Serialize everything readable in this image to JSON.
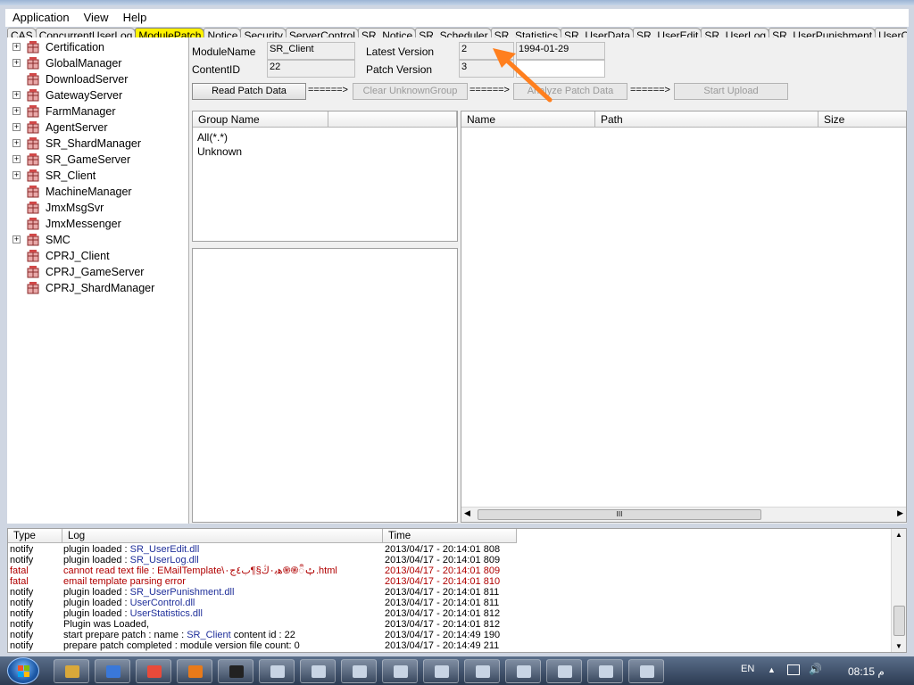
{
  "menu": [
    "Application",
    "View",
    "Help"
  ],
  "tabs": [
    "CAS",
    "ConcurrentUserLog",
    "ModulePatch",
    "Notice",
    "Security",
    "ServerControl",
    "SR_Notice",
    "SR_Scheduler",
    "SR_Statistics",
    "SR_UserData",
    "SR_UserEdit",
    "SR_UserLog",
    "SR_UserPunishment",
    "UserControl"
  ],
  "active_tab": "ModulePatch",
  "tree": [
    {
      "label": "Certification",
      "expandable": true
    },
    {
      "label": "GlobalManager",
      "expandable": true
    },
    {
      "label": "DownloadServer",
      "expandable": false
    },
    {
      "label": "GatewayServer",
      "expandable": true
    },
    {
      "label": "FarmManager",
      "expandable": true
    },
    {
      "label": "AgentServer",
      "expandable": true
    },
    {
      "label": "SR_ShardManager",
      "expandable": true
    },
    {
      "label": "SR_GameServer",
      "expandable": true
    },
    {
      "label": "SR_Client",
      "expandable": true
    },
    {
      "label": "MachineManager",
      "expandable": false
    },
    {
      "label": "JmxMsgSvr",
      "expandable": false
    },
    {
      "label": "JmxMessenger",
      "expandable": false
    },
    {
      "label": "SMC",
      "expandable": true
    },
    {
      "label": "CPRJ_Client",
      "expandable": false
    },
    {
      "label": "CPRJ_GameServer",
      "expandable": false
    },
    {
      "label": "CPRJ_ShardManager",
      "expandable": false
    }
  ],
  "module": {
    "module_name_label": "ModuleName",
    "module_name": "SR_Client",
    "content_id_label": "ContentID",
    "content_id": "22",
    "latest_version_label": "Latest Version",
    "latest_version": "2",
    "latest_date": "1994-01-29",
    "patch_version_label": "Patch Version",
    "patch_version": "3",
    "patch_date": ""
  },
  "actions": {
    "read_patch": "Read Patch Data",
    "arrow1": "======>",
    "clear_unknown": "Clear UnknownGroup",
    "arrow2": "======>",
    "analyze": "Analyze Patch Data",
    "arrow3": "======>",
    "start_upload": "Start Upload"
  },
  "groups": {
    "header": "Group Name",
    "items": [
      "All(*.*)",
      "Unknown"
    ]
  },
  "files": {
    "headers": [
      "Name",
      "Path",
      "Size"
    ],
    "scroll_grip": "III"
  },
  "log": {
    "headers": [
      "Type",
      "Log",
      "Time"
    ],
    "rows": [
      {
        "type": "notify",
        "msg_prefix": "plugin loaded : ",
        "msg_hl": "SR_UserEdit.dll",
        "msg_suffix": "",
        "time": "2013/04/17 - 20:14:01 808"
      },
      {
        "type": "notify",
        "msg_prefix": "plugin loaded : ",
        "msg_hl": "SR_UserLog.dll",
        "msg_suffix": "",
        "time": "2013/04/17 - 20:14:01 809"
      },
      {
        "type": "fatal",
        "msg_prefix": "cannot read text file : EMailTemplate\\ࢡᬀ֎֍ﻫﺑ۰ڭ§¶ﺏ٤ﺝ۰.html",
        "msg_hl": "",
        "msg_suffix": "",
        "time": "2013/04/17 - 20:14:01 809"
      },
      {
        "type": "fatal",
        "msg_prefix": "email template parsing error",
        "msg_hl": "",
        "msg_suffix": "",
        "time": "2013/04/17 - 20:14:01 810"
      },
      {
        "type": "notify",
        "msg_prefix": "plugin loaded : ",
        "msg_hl": "SR_UserPunishment.dll",
        "msg_suffix": "",
        "time": "2013/04/17 - 20:14:01 811"
      },
      {
        "type": "notify",
        "msg_prefix": "plugin loaded : ",
        "msg_hl": "UserControl.dll",
        "msg_suffix": "",
        "time": "2013/04/17 - 20:14:01 811"
      },
      {
        "type": "notify",
        "msg_prefix": "plugin loaded : ",
        "msg_hl": "UserStatistics.dll",
        "msg_suffix": "",
        "time": "2013/04/17 - 20:14:01 812"
      },
      {
        "type": "notify",
        "msg_prefix": "Plugin was Loaded,",
        "msg_hl": "",
        "msg_suffix": "",
        "time": "2013/04/17 - 20:14:01 812"
      },
      {
        "type": "notify",
        "msg_prefix": "start prepare patch : name : ",
        "msg_hl": "SR_Client",
        "msg_suffix": " content id : 22",
        "time": "2013/04/17 - 20:14:49 190"
      },
      {
        "type": "notify",
        "msg_prefix": "prepare patch completed : module version file count: 0",
        "msg_hl": "",
        "msg_suffix": "",
        "time": "2013/04/17 - 20:14:49 211"
      }
    ]
  },
  "taskbar": {
    "lang": "EN",
    "clock": "08:15 م",
    "app_count": 16
  },
  "colors": {
    "fatal": "#b00000",
    "highlight": "#1f2f9a",
    "active_tab": "#fff200",
    "arrow": "#ff7f1e"
  }
}
